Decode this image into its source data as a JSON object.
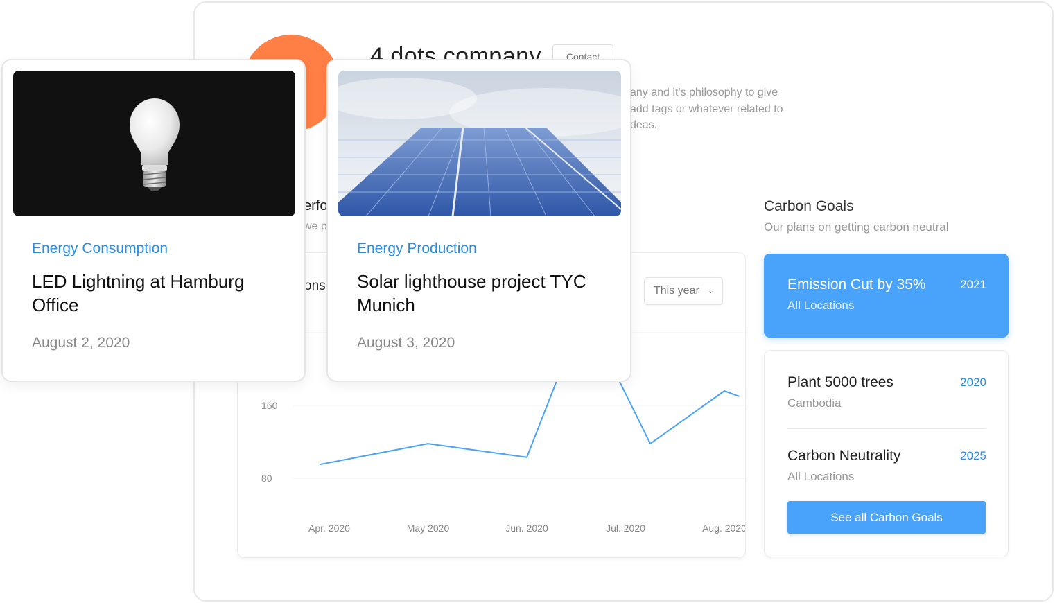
{
  "company": {
    "title": "4 dots company",
    "contact_label": "Contact",
    "about_lines": [
      "any and it’s philosophy to give",
      "add tags or whatever related to",
      "deas."
    ]
  },
  "performance": {
    "title": "erfo",
    "subtitle": "we p"
  },
  "chart_card": {
    "title": "ons",
    "period_select": "This year"
  },
  "chart_data": {
    "type": "line",
    "categories": [
      "Apr. 2020",
      "May 2020",
      "Jun. 2020",
      "Jul. 2020",
      "Aug. 2020"
    ],
    "y_ticks": [
      80,
      160
    ],
    "series": [
      {
        "x": [
          "Apr. 2020",
          "May 2020",
          "Jun. 2020",
          "Jul. 2020",
          "Aug. 2020"
        ],
        "values": [
          95,
          125,
          110,
          114,
          176
        ],
        "color": "#4aa3fa"
      }
    ],
    "points_detail": [
      {
        "x": -0.1,
        "y": 95
      },
      {
        "x": 1.0,
        "y": 118
      },
      {
        "x": 2.0,
        "y": 103
      },
      {
        "x": 2.45,
        "y": 228
      },
      {
        "x": 2.75,
        "y": 228
      },
      {
        "x": 3.25,
        "y": 118
      },
      {
        "x": 4.0,
        "y": 176
      },
      {
        "x": 4.15,
        "y": 170
      }
    ],
    "ylim": [
      40,
      240
    ],
    "grid": true
  },
  "articles": [
    {
      "category": "Energy Consumption",
      "title": "LED Lightning at Hamburg Office",
      "date": "August 2, 2020",
      "image": "lightbulb-photo"
    },
    {
      "category": "Energy Production",
      "title": "Solar lighthouse project TYC Munich",
      "date": "August 3, 2020",
      "image": "solar-panel-photo"
    }
  ],
  "carbon_goals": {
    "title": "Carbon Goals",
    "subtitle": "Our plans on getting carbon neutral",
    "highlight": {
      "title": "Emission Cut by 35%",
      "year": "2021",
      "location": "All Locations"
    },
    "items": [
      {
        "title": "Plant 5000 trees",
        "year": "2020",
        "location": "Cambodia"
      },
      {
        "title": "Carbon Neutrality",
        "year": "2025",
        "location": "All Locations"
      }
    ],
    "see_all_label": "See all Carbon Goals"
  },
  "colors": {
    "accent": "#4aa3fa",
    "link": "#2b8de6",
    "logo": "#ff7f45"
  }
}
